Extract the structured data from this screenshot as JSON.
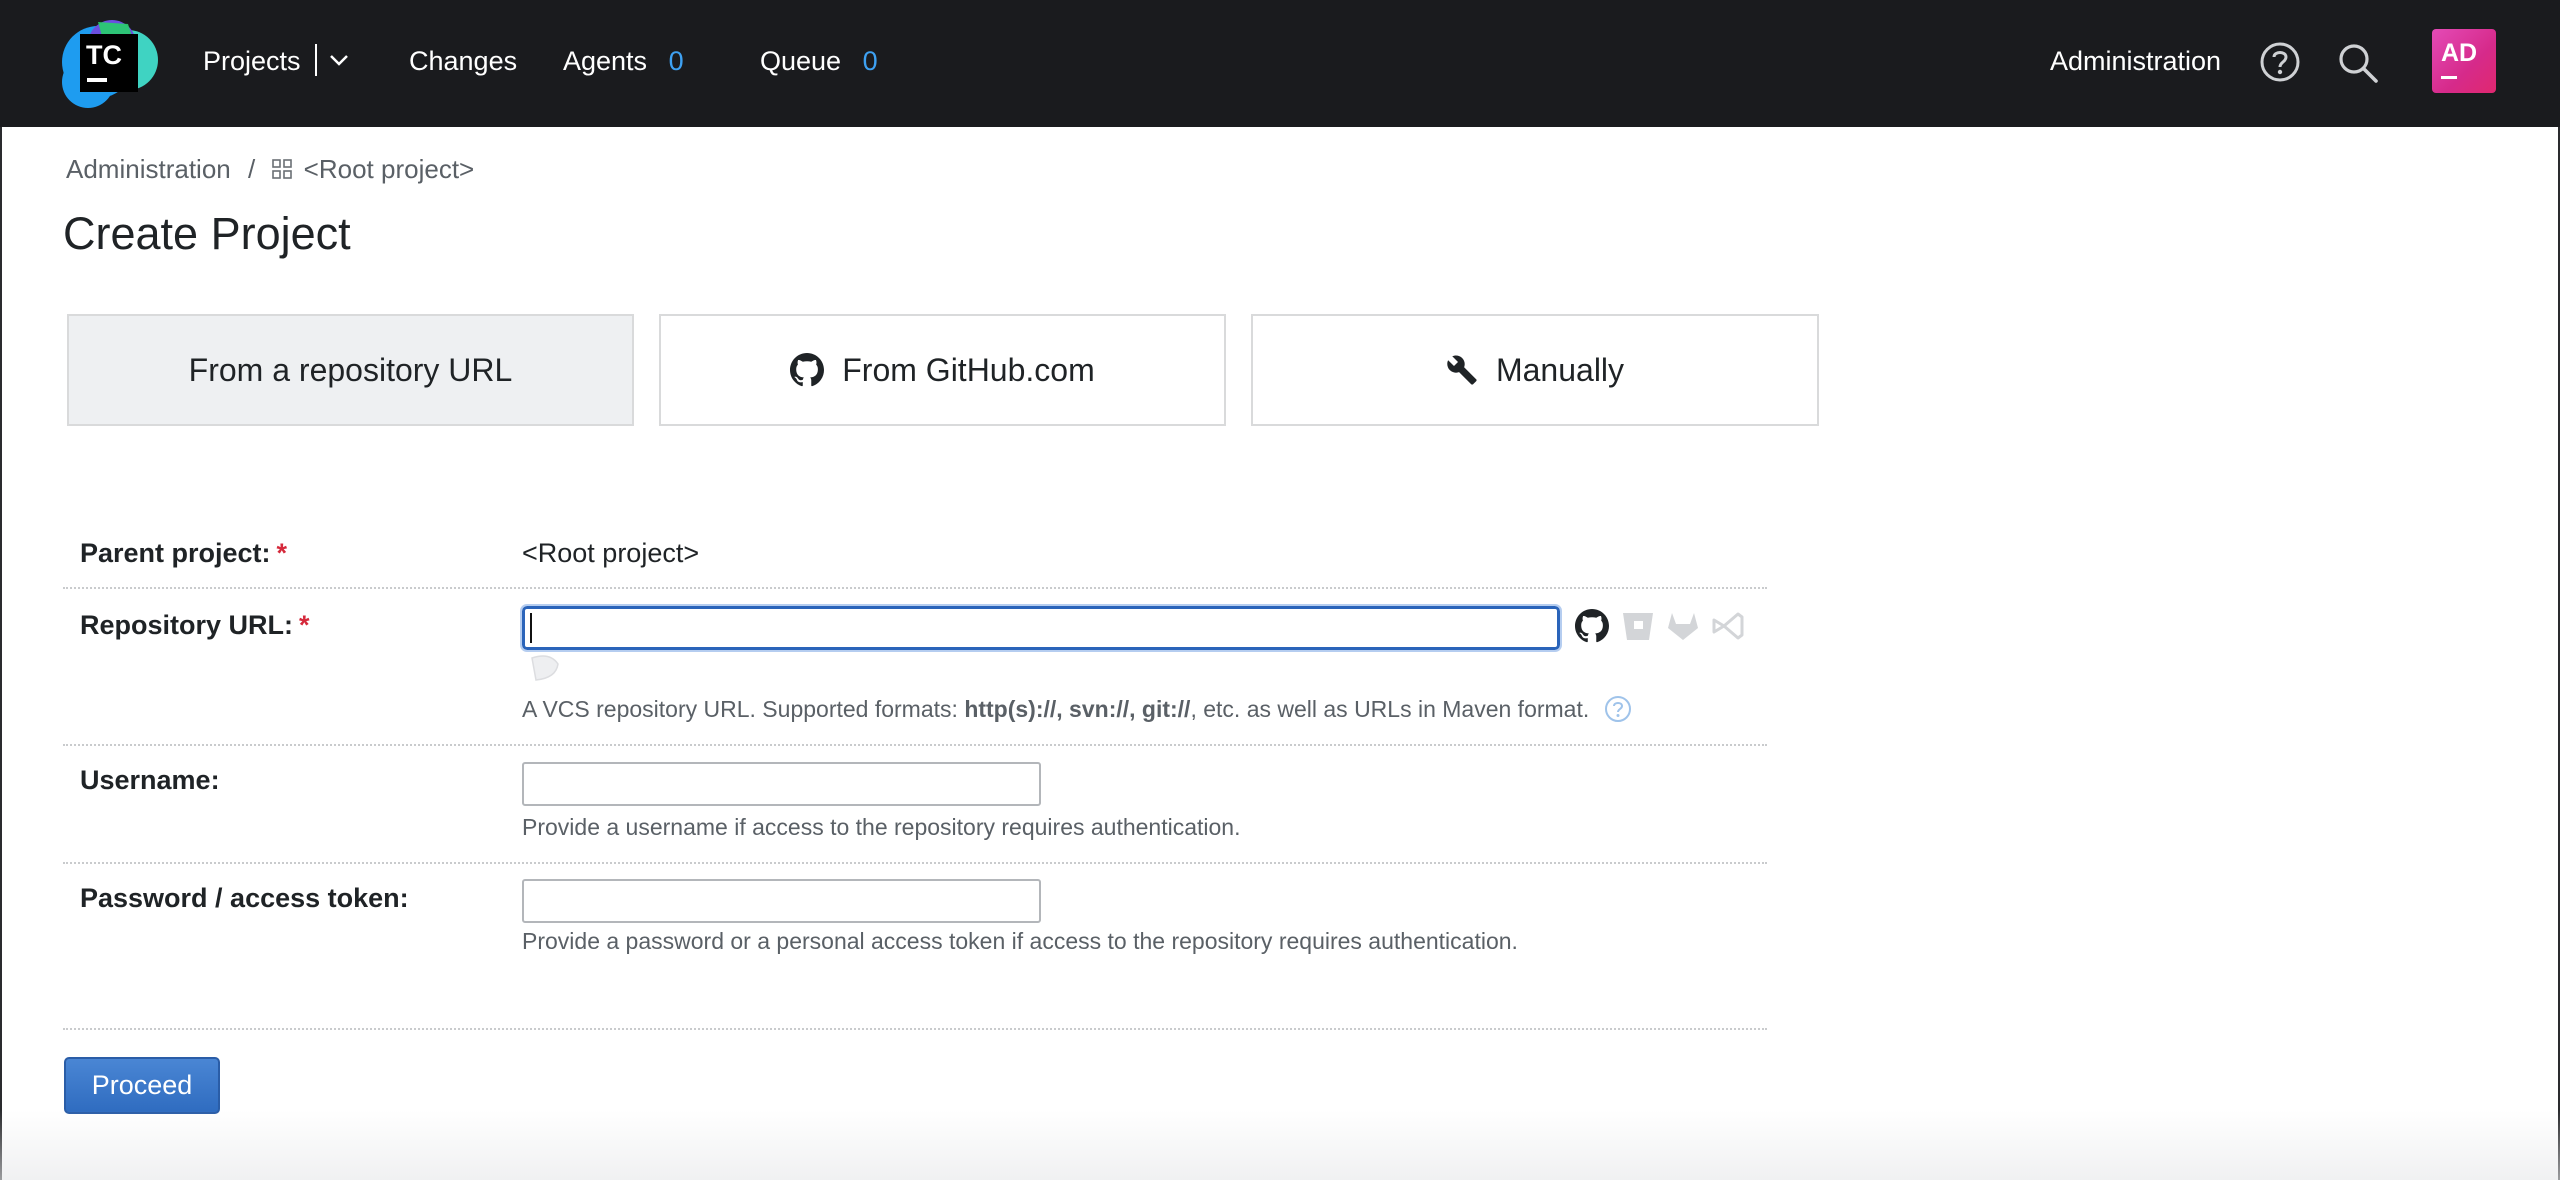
{
  "header": {
    "logo_text": "TC",
    "nav": {
      "projects_label": "Projects",
      "changes_label": "Changes",
      "agents_label": "Agents",
      "agents_count": "0",
      "queue_label": "Queue",
      "queue_count": "0"
    },
    "administration_label": "Administration",
    "avatar_initials": "AD",
    "icons": [
      "help-icon",
      "search-icon"
    ]
  },
  "breadcrumb": {
    "root": "Administration",
    "separator": "/",
    "current": "<Root project>"
  },
  "page_title": "Create Project",
  "tabs": [
    {
      "label": "From a repository URL",
      "selected": true,
      "icon": null
    },
    {
      "label": "From GitHub.com",
      "selected": false,
      "icon": "github-icon"
    },
    {
      "label": "Manually",
      "selected": false,
      "icon": "wrench-icon"
    }
  ],
  "form": {
    "parent_project": {
      "label": "Parent project:",
      "required_mark": "*",
      "value": "<Root project>"
    },
    "repository_url": {
      "label": "Repository URL:",
      "required_mark": "*",
      "value": "",
      "hint_prefix": "A VCS repository URL. Supported formats: ",
      "hint_formats": "http(s)://, svn://, git://",
      "hint_suffix": ", etc. as well as URLs in Maven format.",
      "vcs_icons": [
        "github-icon",
        "bitbucket-icon",
        "gitlab-icon",
        "azure-devops-icon"
      ]
    },
    "username": {
      "label": "Username:",
      "value": "",
      "hint": "Provide a username if access to the repository requires authentication."
    },
    "password": {
      "label": "Password / access token:",
      "value": "",
      "hint": "Provide a password or a personal access token if access to the repository requires authentication."
    }
  },
  "proceed_label": "Proceed",
  "colors": {
    "header_bg": "#1a1b1e",
    "accent_blue": "#3ea1f2",
    "button_blue": "#2f6cc0",
    "required_red": "#d5293b",
    "avatar": "#d62a8a"
  }
}
